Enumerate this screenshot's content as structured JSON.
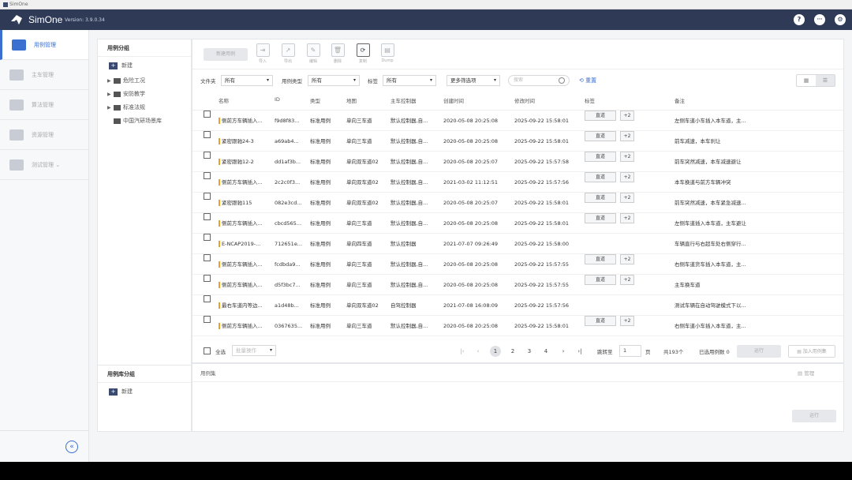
{
  "window": {
    "title": "SimOne"
  },
  "header": {
    "brand": "SimOne",
    "version": "Version: 3.9.0.34",
    "help": "?",
    "more": "···",
    "settings": "⚙"
  },
  "sidebar": {
    "items": [
      {
        "label": "用例管理",
        "icon": "folder-icon",
        "active": true
      },
      {
        "label": "主车管理",
        "icon": "car-icon",
        "active": false
      },
      {
        "label": "算法管理",
        "icon": "code-icon",
        "active": false
      },
      {
        "label": "资源管理",
        "icon": "box-icon",
        "active": false
      },
      {
        "label": "测试管理",
        "icon": "checklist-icon",
        "active": false,
        "caret": "⌄"
      }
    ],
    "collapse": "«"
  },
  "tree": {
    "title": "用例分组",
    "new_label": "新建",
    "plus": "+",
    "items": [
      {
        "label": "危险工况",
        "arrow": "▶"
      },
      {
        "label": "安防教学",
        "arrow": "▶"
      },
      {
        "label": "标准法规",
        "arrow": "▶"
      },
      {
        "label": "中国汽研场景库",
        "arrow": ""
      }
    ],
    "lib_title": "用例库分组",
    "lib_new_label": "新建"
  },
  "toolbar": {
    "new_case": "新建用例",
    "buttons": [
      {
        "label": "导入",
        "icon": "⇥",
        "on": false
      },
      {
        "label": "导出",
        "icon": "↗",
        "on": false
      },
      {
        "label": "编辑",
        "icon": "✎",
        "on": false
      },
      {
        "label": "删除",
        "icon": "🗑",
        "on": false
      },
      {
        "label": "复制",
        "icon": "⟳",
        "on": true
      },
      {
        "label": "Dump",
        "icon": "▤",
        "on": false
      }
    ]
  },
  "filters": {
    "folder_label": "文件夹",
    "folder_value": "所有",
    "type_label": "用例类型",
    "type_value": "所有",
    "tag_label": "标签",
    "tag_value": "所有",
    "more": "更多筛选项",
    "search_placeholder": "搜索",
    "reset": "重置",
    "caret": "▾"
  },
  "table": {
    "columns": [
      "名称",
      "ID",
      "类型",
      "地图",
      "主车控制器",
      "创建时间",
      "修改时间",
      "标签",
      "备注"
    ],
    "rows": [
      {
        "name": "侧前方车辆插入...",
        "id": "f9d8f83...",
        "type": "标准用例",
        "map": "单向三车道",
        "ctrl": "默认控制器,自...",
        "created": "2020-05-08 20:25:08",
        "modified": "2025-09-22 15:58:01",
        "tag": "直道",
        "more": "+2",
        "note": "左侧车道小车插入本车道，主..."
      },
      {
        "name": "紧密跟驰24-3",
        "id": "a69ab4...",
        "type": "标准用例",
        "map": "单向三车道",
        "ctrl": "默认控制器,自...",
        "created": "2020-05-08 20:25:08",
        "modified": "2025-09-22 15:58:01",
        "tag": "直道",
        "more": "+2",
        "note": "前车减速，本车刹让"
      },
      {
        "name": "紧密跟驰12-2",
        "id": "dd1af3b...",
        "type": "标准用例",
        "map": "单向双车道02",
        "ctrl": "默认控制器,自...",
        "created": "2020-05-08 20:25:07",
        "modified": "2025-09-22 15:57:58",
        "tag": "直道",
        "more": "+2",
        "note": "前车突然减速，本车减速避让"
      },
      {
        "name": "侧前方车辆插入...",
        "id": "2c2c0f3...",
        "type": "标准用例",
        "map": "单向双车道02",
        "ctrl": "默认控制器,自...",
        "created": "2021-03-02 11:12:51",
        "modified": "2025-09-22 15:57:56",
        "tag": "直道",
        "more": "+2",
        "note": "本车换道与前方车辆冲突"
      },
      {
        "name": "紧密跟驰115",
        "id": "082e3cd...",
        "type": "标准用例",
        "map": "单向双车道02",
        "ctrl": "默认控制器,自...",
        "created": "2020-05-08 20:25:07",
        "modified": "2025-09-22 15:58:01",
        "tag": "直道",
        "more": "+2",
        "note": "前车突然减速，本车紧急减速..."
      },
      {
        "name": "侧前方车辆插入...",
        "id": "cbcd565...",
        "type": "标准用例",
        "map": "单向三车道",
        "ctrl": "默认控制器,自...",
        "created": "2020-05-08 20:25:08",
        "modified": "2025-09-22 15:58:01",
        "tag": "直道",
        "more": "+2",
        "note": "左侧车道插入本车道，主车避让"
      },
      {
        "name": "E-NCAP2019-...",
        "id": "712651e...",
        "type": "标准用例",
        "map": "单向四车道",
        "ctrl": "默认控制器",
        "created": "2021-07-07 09:26:49",
        "modified": "2025-09-22 15:58:00",
        "tag": "",
        "more": "",
        "note": "车辆直行与右超车处右侧穿行..."
      },
      {
        "name": "侧前方车辆插入...",
        "id": "fcdbda9...",
        "type": "标准用例",
        "map": "单向三车道",
        "ctrl": "默认控制器,自...",
        "created": "2020-05-08 20:25:08",
        "modified": "2025-09-22 15:57:55",
        "tag": "直道",
        "more": "+2",
        "note": "右侧车道货车插入本车道，主..."
      },
      {
        "name": "侧前方车辆插入...",
        "id": "d5f3bc7...",
        "type": "标准用例",
        "map": "单向三车道",
        "ctrl": "默认控制器,自...",
        "created": "2020-05-08 20:25:08",
        "modified": "2025-09-22 15:57:55",
        "tag": "直道",
        "more": "+2",
        "note": "主车换车道"
      },
      {
        "name": "最右车道内等边...",
        "id": "a1d48b...",
        "type": "标准用例",
        "map": "单向双车道02",
        "ctrl": "自驾控制器",
        "created": "2021-07-08 16:08:09",
        "modified": "2025-09-22 15:57:56",
        "tag": "",
        "more": "",
        "note": "测试车辆在自动驾驶模式下以..."
      },
      {
        "name": "侧前方车辆插入...",
        "id": "0367635...",
        "type": "标准用例",
        "map": "单向三车道",
        "ctrl": "默认控制器,自...",
        "created": "2020-05-08 20:25:08",
        "modified": "2025-09-22 15:58:01",
        "tag": "直道",
        "more": "+2",
        "note": "右侧车道小车插入本车道，主..."
      }
    ]
  },
  "pager": {
    "select_all": "全选",
    "batch_placeholder": "批量操作",
    "first": "|‹",
    "prev": "‹",
    "next": "›",
    "last": "›|",
    "pages": [
      "1",
      "2",
      "3",
      "4"
    ],
    "current": "1",
    "jump_label": "跳转至",
    "jump_value": "1",
    "page_unit": "页",
    "total": "共193个",
    "selected": "已选用例数 0",
    "run": "运行",
    "add_to_lib": "加入用例集"
  },
  "lower": {
    "title": "用例集",
    "manage": "管理",
    "run": "运行"
  }
}
